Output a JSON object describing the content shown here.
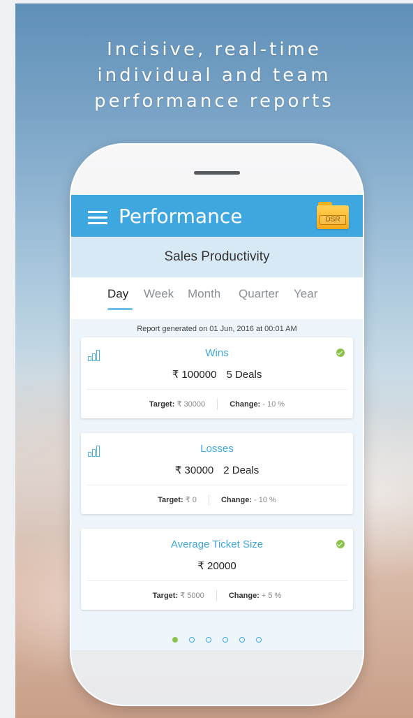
{
  "headline": {
    "line1": "Incisive, real-time",
    "line2": "individual and team",
    "line3": "performance reports"
  },
  "appbar": {
    "title": "Performance",
    "dsr_label": "DSR",
    "menu_icon": "hamburger-menu-icon",
    "dsr_icon": "folder-icon"
  },
  "subheader": {
    "title": "Sales Productivity"
  },
  "tabs": {
    "items": [
      "Day",
      "Week",
      "Month",
      "Quarter",
      "Year"
    ],
    "active": "Day"
  },
  "report_generated": "Report generated on 01 Jun, 2016 at 00:01 AM",
  "cards": [
    {
      "title": "Wins",
      "amount": "₹ 100000",
      "deals": "5 Deals",
      "target_label": "Target:",
      "target_value": "₹ 30000",
      "change_label": "Change:",
      "change_value": "- 10 %",
      "status": "check"
    },
    {
      "title": "Losses",
      "amount": "₹ 30000",
      "deals": "2 Deals",
      "target_label": "Target:",
      "target_value": "₹ 0",
      "change_label": "Change:",
      "change_value": "- 10 %"
    },
    {
      "title": "Average Ticket Size",
      "amount": "₹ 20000",
      "target_label": "Target:",
      "target_value": "₹ 5000",
      "change_label": "Change:",
      "change_value": "+ 5 %",
      "status": "check"
    }
  ],
  "pagination": {
    "total": 6,
    "current": 1
  },
  "colors": {
    "accent": "#3ea7df",
    "subheader_bg": "#d6e9f5",
    "success": "#8bc34a",
    "folder": "#f3a81a"
  }
}
